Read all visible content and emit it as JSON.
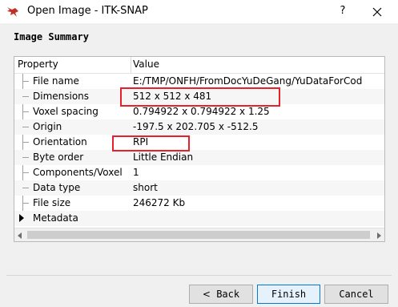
{
  "window": {
    "title": "Open Image - ITK-SNAP",
    "help_label": "?"
  },
  "section": {
    "title": "Image Summary"
  },
  "table": {
    "headers": [
      "Property",
      "Value"
    ],
    "rows": [
      {
        "property": "File name",
        "value": "E:/TMP/ONFH/FromDocYuDeGang/YuDataForCod"
      },
      {
        "property": "Dimensions",
        "value": "512 x 512 x 481"
      },
      {
        "property": "Voxel spacing",
        "value": "0.794922 x 0.794922 x 1.25"
      },
      {
        "property": "Origin",
        "value": "-197.5 x 202.705 x -512.5"
      },
      {
        "property": "Orientation",
        "value": "RPI"
      },
      {
        "property": "Byte order",
        "value": "Little Endian"
      },
      {
        "property": "Components/Voxel",
        "value": "1"
      },
      {
        "property": "Data type",
        "value": "short"
      },
      {
        "property": "File size",
        "value": "246272 Kb"
      }
    ],
    "collapsed_group": "Metadata"
  },
  "buttons": {
    "back_arrow": "<",
    "back": "Back",
    "finish": "Finish",
    "cancel": "Cancel"
  },
  "colors": {
    "highlight": "#e8202a",
    "accent": "#0078d7"
  }
}
